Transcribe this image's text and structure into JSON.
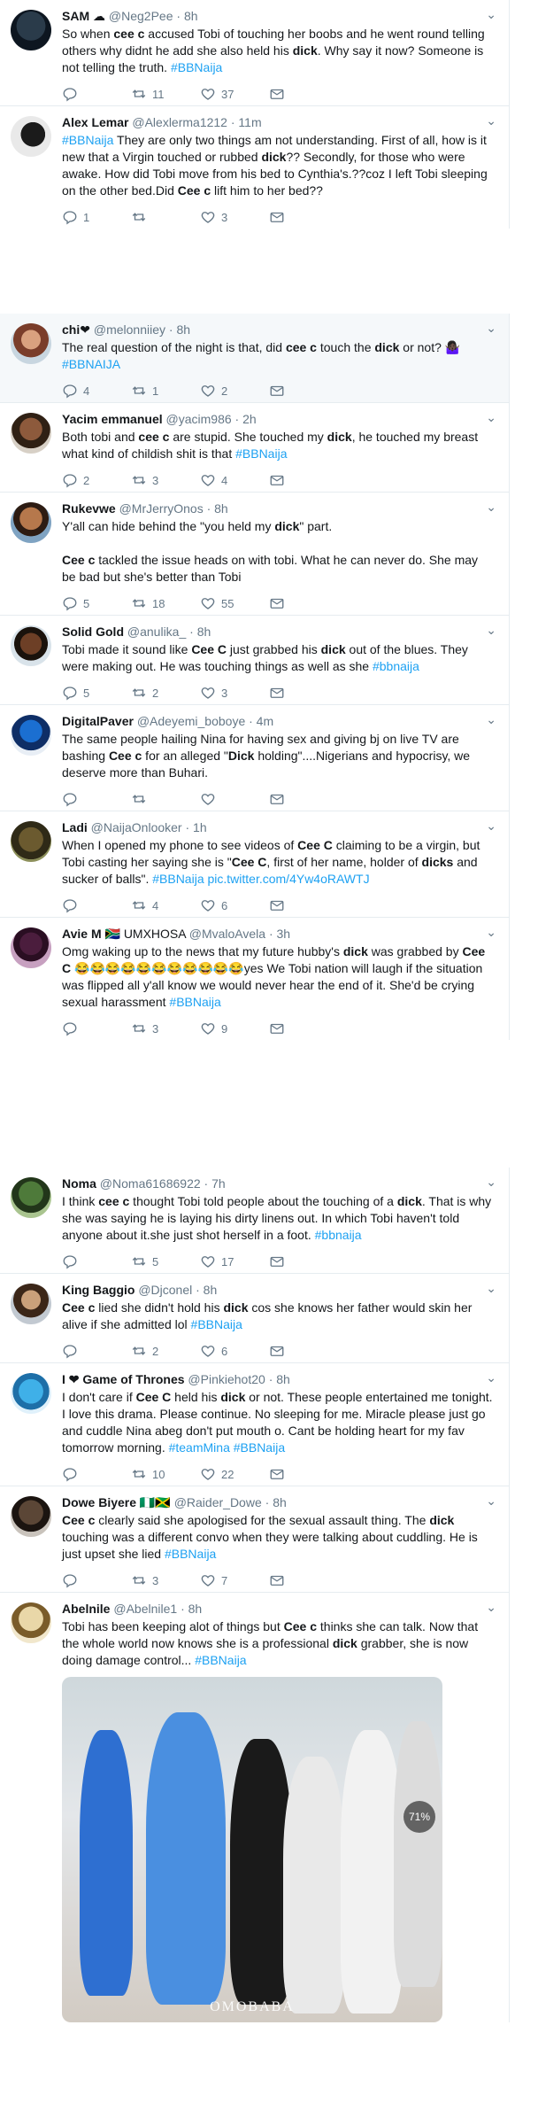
{
  "groups": [
    {
      "tweets": [
        {
          "name": "SAM",
          "name_suffix": " ☁",
          "handle": "@Neg2Pee",
          "time": "8h",
          "text": [
            {
              "t": "So when "
            },
            {
              "t": "cee c",
              "b": true
            },
            {
              "t": " accused Tobi of touching her boobs and he went round telling others why didnt he add she also held his "
            },
            {
              "t": "dick",
              "b": true
            },
            {
              "t": ". Why say it now? Someone is not telling the truth. "
            },
            {
              "t": "#BBNaija",
              "h": true
            }
          ],
          "reply": "",
          "retweet": "11",
          "like": "37"
        },
        {
          "name": "Alex Lemar",
          "name_suffix": "",
          "handle": "@Alexlerma1212",
          "time": "11m",
          "text": [
            {
              "t": "#BBNaija",
              "h": true
            },
            {
              "t": " They are only two things am not understanding. First of all, how is it new that a Virgin touched or rubbed "
            },
            {
              "t": "dick",
              "b": true
            },
            {
              "t": "?? Secondly, for those who were awake. How did Tobi move from his bed to Cynthia's.??coz I left Tobi sleeping on the other bed.Did "
            },
            {
              "t": "Cee c",
              "b": true
            },
            {
              "t": " lift him to her bed??"
            }
          ],
          "reply": "1",
          "retweet": "",
          "like": "3"
        }
      ]
    },
    {
      "tweets": [
        {
          "name": "chi",
          "name_suffix": "❤",
          "handle": "@melonniiey",
          "time": "8h",
          "highlight": true,
          "text": [
            {
              "t": "The real question of the night is that, did "
            },
            {
              "t": "cee c",
              "b": true
            },
            {
              "t": " touch the "
            },
            {
              "t": "dick",
              "b": true
            },
            {
              "t": " or not? 🤷🏿‍♀️ "
            },
            {
              "t": "#BBNAIJA",
              "h": true
            }
          ],
          "reply": "4",
          "retweet": "1",
          "like": "2"
        },
        {
          "name": "Yacim emmanuel",
          "name_suffix": "",
          "handle": "@yacim986",
          "time": "2h",
          "text": [
            {
              "t": "Both tobi and "
            },
            {
              "t": "cee c",
              "b": true
            },
            {
              "t": " are stupid. She touched my "
            },
            {
              "t": "dick",
              "b": true
            },
            {
              "t": ", he touched my breast what kind of childish shit is that "
            },
            {
              "t": "#BBNaija",
              "h": true
            }
          ],
          "reply": "2",
          "retweet": "3",
          "like": "4"
        },
        {
          "name": "Rukevwe",
          "name_suffix": "",
          "handle": "@MrJerryOnos",
          "time": "8h",
          "text": [
            {
              "t": "Y'all can hide behind the \"you held my "
            },
            {
              "t": "dick",
              "b": true
            },
            {
              "t": "\" part."
            }
          ],
          "text2": [
            {
              "t": "Cee c",
              "b": true
            },
            {
              "t": " tackled the issue heads on with tobi. What he can never do. She may be bad but she's better than Tobi"
            }
          ],
          "reply": "5",
          "retweet": "18",
          "like": "55"
        },
        {
          "name": "Solid Gold",
          "name_suffix": "",
          "handle": "@anulika_",
          "time": "8h",
          "text": [
            {
              "t": "Tobi made it sound like "
            },
            {
              "t": "Cee C",
              "b": true
            },
            {
              "t": " just grabbed his "
            },
            {
              "t": "dick",
              "b": true
            },
            {
              "t": " out of the blues. They were making out. He was touching things as well as she "
            },
            {
              "t": "#bbnaija",
              "h": true
            }
          ],
          "reply": "5",
          "retweet": "2",
          "like": "3"
        },
        {
          "name": "DigitalPaver",
          "name_suffix": "",
          "handle": "@Adeyemi_boboye",
          "time": "4m",
          "text": [
            {
              "t": "The same people hailing Nina for having sex and giving bj on live TV are bashing "
            },
            {
              "t": "Cee c",
              "b": true
            },
            {
              "t": " for an alleged \""
            },
            {
              "t": "Dick",
              "b": true
            },
            {
              "t": " holding\"....Nigerians and hypocrisy, we deserve more than Buhari."
            }
          ],
          "reply": "",
          "retweet": "",
          "like": ""
        },
        {
          "name": "Ladi",
          "name_suffix": "",
          "handle": "@NaijaOnlooker",
          "time": "1h",
          "text": [
            {
              "t": "When I opened my phone to see videos of "
            },
            {
              "t": "Cee C",
              "b": true
            },
            {
              "t": " claiming to be a virgin, but Tobi casting her saying she is \""
            },
            {
              "t": "Cee C",
              "b": true
            },
            {
              "t": ", first of her name, holder of "
            },
            {
              "t": "dicks",
              "b": true
            },
            {
              "t": " and sucker of balls\". "
            },
            {
              "t": "#BBNaija pic.twitter.com/4Yw4oRAWTJ",
              "h": true
            }
          ],
          "reply": "",
          "retweet": "4",
          "like": "6"
        },
        {
          "name": "Avie M",
          "name_suffix": " 🇿🇦 UMXHOSA",
          "handle": "@MvaloAvela",
          "time": "3h",
          "text": [
            {
              "t": "Omg waking up to the news that my future hubby's "
            },
            {
              "t": "dick",
              "b": true
            },
            {
              "t": " was grabbed by "
            },
            {
              "t": "Cee C",
              "b": true
            },
            {
              "t": " 😂😂😂😂😂😂😂😂😂😂😂yes We Tobi nation will laugh if the situation was flipped all y'all know we would never hear the end of it. She'd be crying sexual harassment "
            },
            {
              "t": "#BBNaija",
              "h": true
            }
          ],
          "reply": "",
          "retweet": "3",
          "like": "9"
        }
      ]
    },
    {
      "tweets": [
        {
          "name": "Noma",
          "name_suffix": "",
          "handle": "@Noma61686922",
          "time": "7h",
          "text": [
            {
              "t": "I think "
            },
            {
              "t": "cee c",
              "b": true
            },
            {
              "t": " thought Tobi told people about the touching of a "
            },
            {
              "t": "dick",
              "b": true
            },
            {
              "t": ". That is why she was saying he is laying  his dirty linens out. In which Tobi haven't told anyone about it.she just shot herself in a foot. "
            },
            {
              "t": "#bbnaija",
              "h": true
            }
          ],
          "reply": "",
          "retweet": "5",
          "like": "17"
        },
        {
          "name": "King Baggio",
          "name_suffix": "",
          "handle": "@Djconel",
          "time": "8h",
          "text": [
            {
              "t": "Cee c",
              "b": true
            },
            {
              "t": " lied she didn't hold his "
            },
            {
              "t": "dick",
              "b": true
            },
            {
              "t": " cos she knows her father would skin her alive if she admitted lol "
            },
            {
              "t": "#BBNaija",
              "h": true
            }
          ],
          "reply": "",
          "retweet": "2",
          "like": "6"
        },
        {
          "name": "I ❤ Game of Thrones",
          "name_suffix": "",
          "handle": "@Pinkiehot20",
          "time": "8h",
          "text": [
            {
              "t": "I don't care if "
            },
            {
              "t": "Cee C",
              "b": true
            },
            {
              "t": " held his "
            },
            {
              "t": "dick",
              "b": true
            },
            {
              "t": " or not. These people entertained me tonight. I love this drama. Please continue. No sleeping for me. Miracle please just go and cuddle Nina abeg don't put mouth o. Cant be holding heart for my fav tomorrow morning. "
            },
            {
              "t": "#teamMina #BBNaija",
              "h": true
            }
          ],
          "reply": "",
          "retweet": "10",
          "like": "22"
        },
        {
          "name": "Dowe Biyere",
          "name_suffix": " 🇳🇬🇯🇲",
          "handle": "@Raider_Dowe",
          "time": "8h",
          "text": [
            {
              "t": "Cee c",
              "b": true
            },
            {
              "t": " clearly said she apologised for the sexual assault thing. The "
            },
            {
              "t": "dick",
              "b": true
            },
            {
              "t": " touching was a different convo when they were talking about cuddling. He is just upset she lied "
            },
            {
              "t": "#BBNaija",
              "h": true
            }
          ],
          "reply": "",
          "retweet": "3",
          "like": "7"
        },
        {
          "name": "Abelnile",
          "name_suffix": "",
          "handle": "@Abelnile1",
          "time": "8h",
          "text": [
            {
              "t": "Tobi has been keeping alot of things but "
            },
            {
              "t": "Cee c",
              "b": true
            },
            {
              "t": " thinks she can talk. Now that the whole world now knows she is a professional "
            },
            {
              "t": "dick",
              "b": true
            },
            {
              "t": " grabber,  she is now doing damage control... "
            },
            {
              "t": "#BBNaija",
              "h": true
            }
          ],
          "photo": {
            "badge": "71%",
            "watermark": "OMOBABA"
          },
          "reply": "",
          "retweet": "",
          "like": ""
        }
      ]
    }
  ],
  "colors": {
    "link": "#1da1f2",
    "muted": "#657786",
    "text": "#14171a",
    "border": "#e6ecf0"
  }
}
